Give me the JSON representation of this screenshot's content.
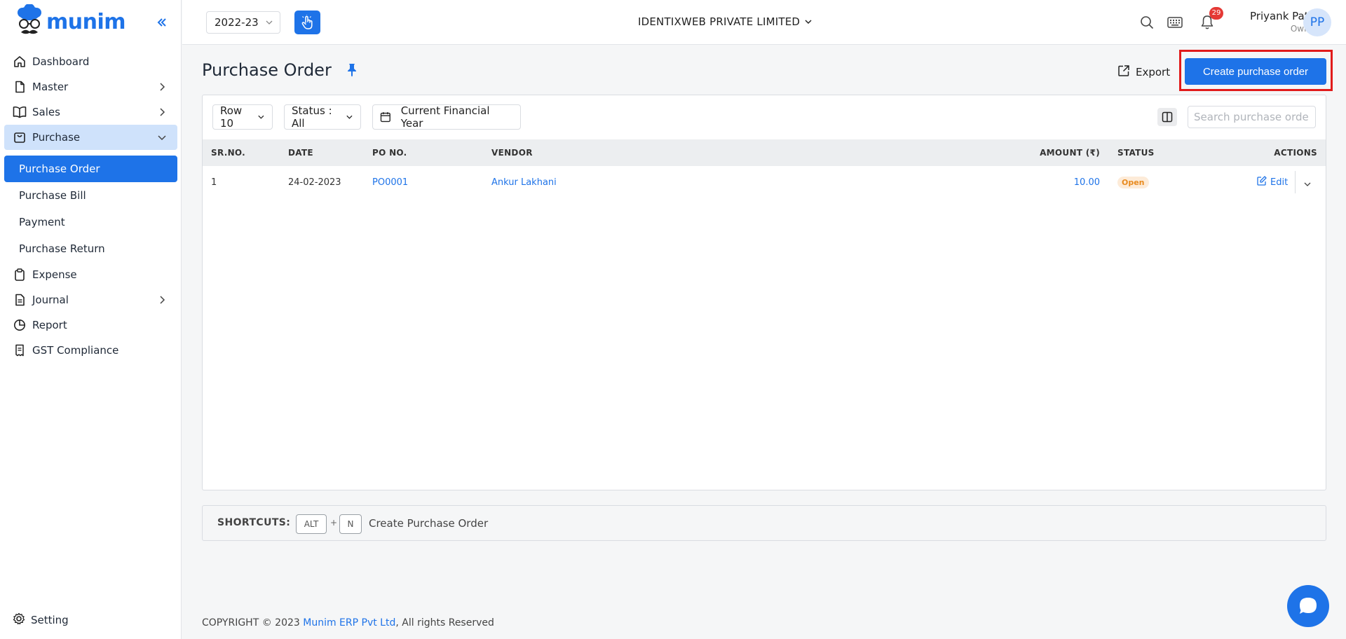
{
  "app": {
    "name": "munim",
    "brand_color": "#1e73e8"
  },
  "sidebar": {
    "items": [
      {
        "label": "Dashboard",
        "icon": "home-icon"
      },
      {
        "label": "Master",
        "icon": "file-icon",
        "expandable": true
      },
      {
        "label": "Sales",
        "icon": "book-icon",
        "expandable": true
      },
      {
        "label": "Purchase",
        "icon": "bag-icon",
        "expandable": true,
        "expanded": true,
        "children": [
          {
            "label": "Purchase Order",
            "active": true
          },
          {
            "label": "Purchase Bill"
          },
          {
            "label": "Payment"
          },
          {
            "label": "Purchase Return"
          }
        ]
      },
      {
        "label": "Expense",
        "icon": "clipboard-icon"
      },
      {
        "label": "Journal",
        "icon": "document-icon",
        "expandable": true
      },
      {
        "label": "Report",
        "icon": "pie-chart-icon"
      },
      {
        "label": "GST Compliance",
        "icon": "receipt-icon"
      }
    ],
    "setting_label": "Setting"
  },
  "topbar": {
    "financial_year": "2022-23",
    "company": "IDENTIXWEB PRIVATE LIMITED",
    "notification_count": "29",
    "user_name": "Priyank Patel",
    "user_role": "Owner",
    "user_initials": "PP"
  },
  "page": {
    "title": "Purchase Order",
    "export_label": "Export",
    "create_label": "Create purchase order"
  },
  "filters": {
    "rows": "Row 10",
    "status": "Status : All",
    "period": "Current Financial Year",
    "search_placeholder": "Search purchase order"
  },
  "table": {
    "headers": {
      "sr": "SR.NO.",
      "date": "DATE",
      "po": "PO NO.",
      "vendor": "VENDOR",
      "amount": "AMOUNT (₹)",
      "status": "STATUS",
      "actions": "ACTIONS"
    },
    "rows": [
      {
        "sr": "1",
        "date": "24-02-2023",
        "po": "PO0001",
        "vendor": "Ankur Lakhani",
        "amount": "10.00",
        "status": "Open",
        "action": "Edit"
      }
    ]
  },
  "shortcuts": {
    "label": "SHORTCUTS:",
    "key1": "ALT",
    "plus": "+",
    "key2": "N",
    "description": "Create Purchase Order"
  },
  "footer": {
    "prefix": "COPYRIGHT © 2023 ",
    "brand": "Munim ERP Pvt Ltd",
    "suffix": ", All rights Reserved"
  }
}
